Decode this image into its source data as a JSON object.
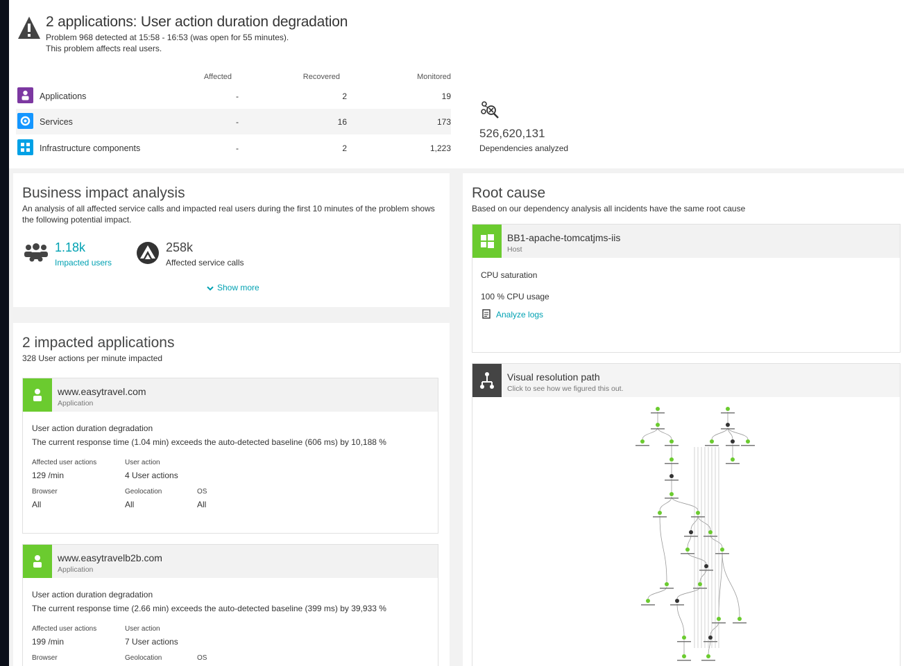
{
  "problem": {
    "title": "2 applications: User action duration degradation",
    "detected": "Problem 968 detected at 15:58 - 16:53 (was open for 55 minutes).",
    "affects": "This problem affects real users."
  },
  "summary": {
    "columns": [
      "Affected",
      "Recovered",
      "Monitored"
    ],
    "rows": [
      {
        "label": "Applications",
        "affected": "-",
        "recovered": "2",
        "monitored": "19",
        "color": "#7c38a1"
      },
      {
        "label": "Services",
        "affected": "-",
        "recovered": "16",
        "monitored": "173",
        "color": "#1496ff"
      },
      {
        "label": "Infrastructure components",
        "affected": "-",
        "recovered": "2",
        "monitored": "1,223",
        "color": "#00a1e6"
      }
    ],
    "dependencies_value": "526,620,131",
    "dependencies_label": "Dependencies analyzed"
  },
  "business": {
    "title": "Business impact analysis",
    "description": "An analysis of all affected service calls and impacted real users during the first 10 minutes of the problem shows the following potential impact.",
    "users_value": "1.18k",
    "users_label": "Impacted users",
    "calls_value": "258k",
    "calls_label": "Affected service calls",
    "show_more": "Show more"
  },
  "impacted": {
    "title": "2 impacted applications",
    "subtitle": "328 User actions per minute impacted",
    "apps": [
      {
        "name": "www.easytravel.com",
        "type": "Application",
        "issue": "User action duration degradation",
        "detail": "The current response time (1.04 min) exceeds the auto-detected baseline (606 ms) by 10,188 %",
        "affected_label": "Affected user actions",
        "affected_value": "129 /min",
        "action_label": "User action",
        "action_value": "4 User actions",
        "browser_label": "Browser",
        "browser_value": "All",
        "geo_label": "Geolocation",
        "geo_value": "All",
        "os_label": "OS",
        "os_value": "All"
      },
      {
        "name": "www.easytravelb2b.com",
        "type": "Application",
        "issue": "User action duration degradation",
        "detail": "The current response time (2.66 min) exceeds the auto-detected baseline (399 ms) by 39,933 %",
        "affected_label": "Affected user actions",
        "affected_value": "199 /min",
        "action_label": "User action",
        "action_value": "7 User actions",
        "browser_label": "Browser",
        "geo_label": "Geolocation",
        "os_label": "OS"
      }
    ]
  },
  "root_cause": {
    "title": "Root cause",
    "description": "Based on our dependency analysis all incidents have the same root cause",
    "host_name": "BB1-apache-tomcatjms-iis",
    "host_type": "Host",
    "issue": "CPU saturation",
    "metric": "100 % CPU usage",
    "analyze_logs": "Analyze logs"
  },
  "resolution": {
    "title": "Visual resolution path",
    "subtitle": "Click to see how we figured this out."
  },
  "colors": {
    "green": "#6bcb2f",
    "teal": "#00a1b2",
    "dark": "#454646"
  }
}
